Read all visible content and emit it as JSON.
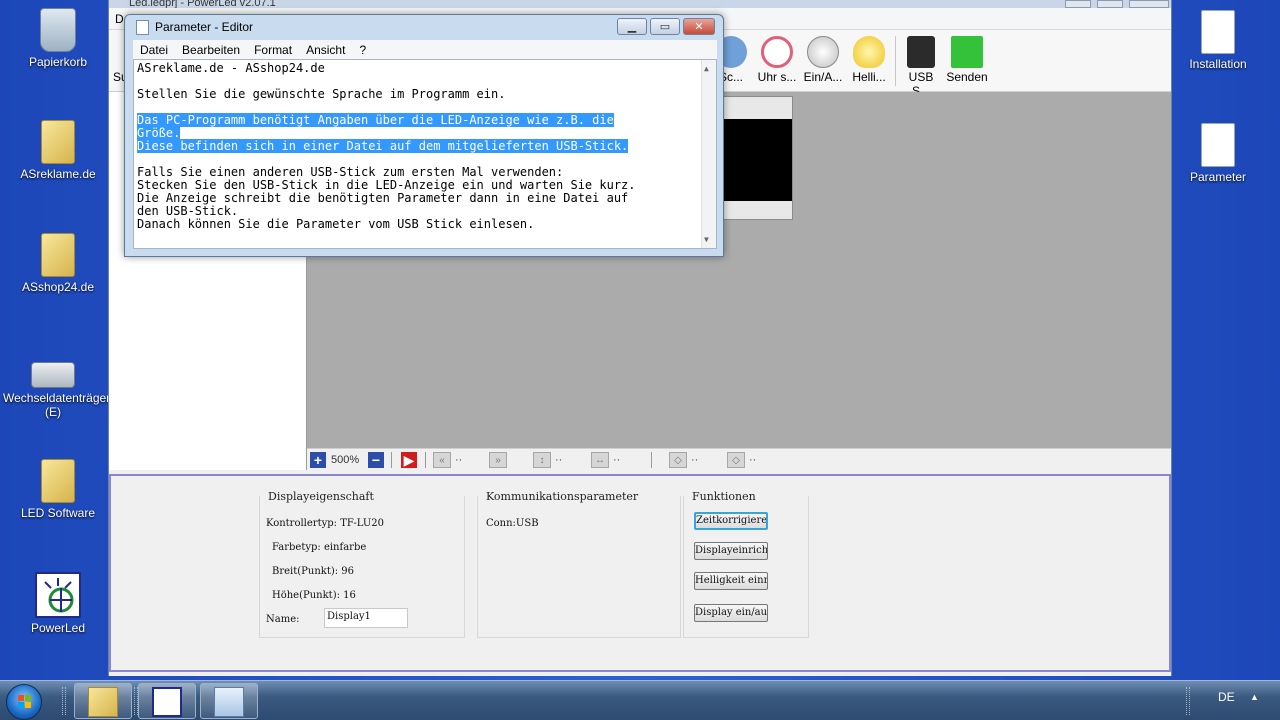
{
  "desktop": {
    "icons": [
      {
        "label": "Papierkorb"
      },
      {
        "label": "ASreklame.de"
      },
      {
        "label": "ASshop24.de"
      },
      {
        "label": "Wechseldatenträger (E)"
      },
      {
        "label": "LED Software"
      },
      {
        "label": "PowerLed"
      },
      {
        "label": "Installation"
      },
      {
        "label": "Parameter"
      }
    ]
  },
  "app": {
    "title": "Led.ledprj - PowerLed v2.07.1",
    "menu_first": "D",
    "toolbar": {
      "cut_left": "Su",
      "items": [
        {
          "label": "Sc...",
          "icon": "cancel-icon"
        },
        {
          "label": "Uhr s...",
          "icon": "alarm-clock-icon"
        },
        {
          "label": "Ein/A...",
          "icon": "power-icon"
        },
        {
          "label": "Helli...",
          "icon": "bulb-icon"
        },
        {
          "label": "USB S...",
          "icon": "usb-icon"
        },
        {
          "label": "Senden",
          "icon": "send-arrow-icon"
        }
      ]
    },
    "zoom": {
      "level": "500%",
      "dots": "··"
    },
    "panel": {
      "display_group": {
        "title": "Displayeigenschaft",
        "controller": "Kontrollertyp: TF-LU20",
        "color_type": "Farbetyp: einfarbe",
        "width": "Breit(Punkt): 96",
        "height": "Höhe(Punkt): 16",
        "name_label": "Name:",
        "name_value": "Display1"
      },
      "comm_group": {
        "title": "Kommunikationsparameter",
        "conn": "Conn:USB"
      },
      "func_group": {
        "title": "Funktionen",
        "buttons": [
          "Zeitkorrigieren",
          "Displayeinrichtung",
          "Helligkeit einrichten",
          "Display ein/aus"
        ]
      }
    }
  },
  "notepad": {
    "title": "Parameter - Editor",
    "menu": [
      "Datei",
      "Bearbeiten",
      "Format",
      "Ansicht",
      "?"
    ],
    "lines": [
      {
        "text": "ASreklame.de - ASshop24.de",
        "sel": false
      },
      {
        "text": "",
        "sel": false
      },
      {
        "text": "Stellen Sie die gewünschte Sprache im Programm ein.",
        "sel": false
      },
      {
        "text": "",
        "sel": false
      },
      {
        "text": "Das PC-Programm benötigt Angaben über die LED-Anzeige wie z.B. die",
        "sel": true
      },
      {
        "text": "Größe.",
        "sel": true
      },
      {
        "text": "Diese befinden sich in einer Datei auf dem mitgelieferten USB-Stick.",
        "sel": true
      },
      {
        "text": "",
        "sel": false
      },
      {
        "text": "Falls Sie einen anderen USB-Stick zum ersten Mal verwenden:",
        "sel": false
      },
      {
        "text": "Stecken Sie den USB-Stick in die LED-Anzeige ein und warten Sie kurz.",
        "sel": false
      },
      {
        "text": "Die Anzeige schreibt die benötigten Parameter dann in eine Datei auf",
        "sel": false
      },
      {
        "text": "den USB-Stick.",
        "sel": false
      },
      {
        "text": "Danach können Sie die Parameter vom USB Stick einlesen.",
        "sel": false
      }
    ]
  },
  "taskbar": {
    "language": "DE"
  }
}
